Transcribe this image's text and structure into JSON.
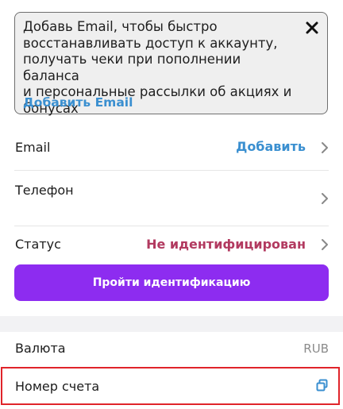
{
  "banner": {
    "text": "Добавь Email, чтобы быстро\nвосстанавливать доступ к аккаунту,\nполучать чеки при пополнении баланса\nи персональные рассылки об акциях и\nбонусах",
    "link_label": "Добавить Email",
    "close_icon": "close-icon"
  },
  "rows": {
    "email": {
      "label": "Email",
      "value": "Добавить"
    },
    "phone": {
      "label": "Телефон"
    },
    "status": {
      "label": "Статус",
      "value": "Не идентифицирован"
    },
    "currency": {
      "label": "Валюта",
      "value": "RUB"
    },
    "account": {
      "label": "Номер счета",
      "icon": "copy-icon"
    }
  },
  "identify_button": {
    "label": "Пройти идентификацию"
  },
  "colors": {
    "accent_purple": "#8d2cf0",
    "link_blue": "#3a8fd0",
    "status_red": "#b23a60",
    "highlight_red": "#e0242a"
  }
}
